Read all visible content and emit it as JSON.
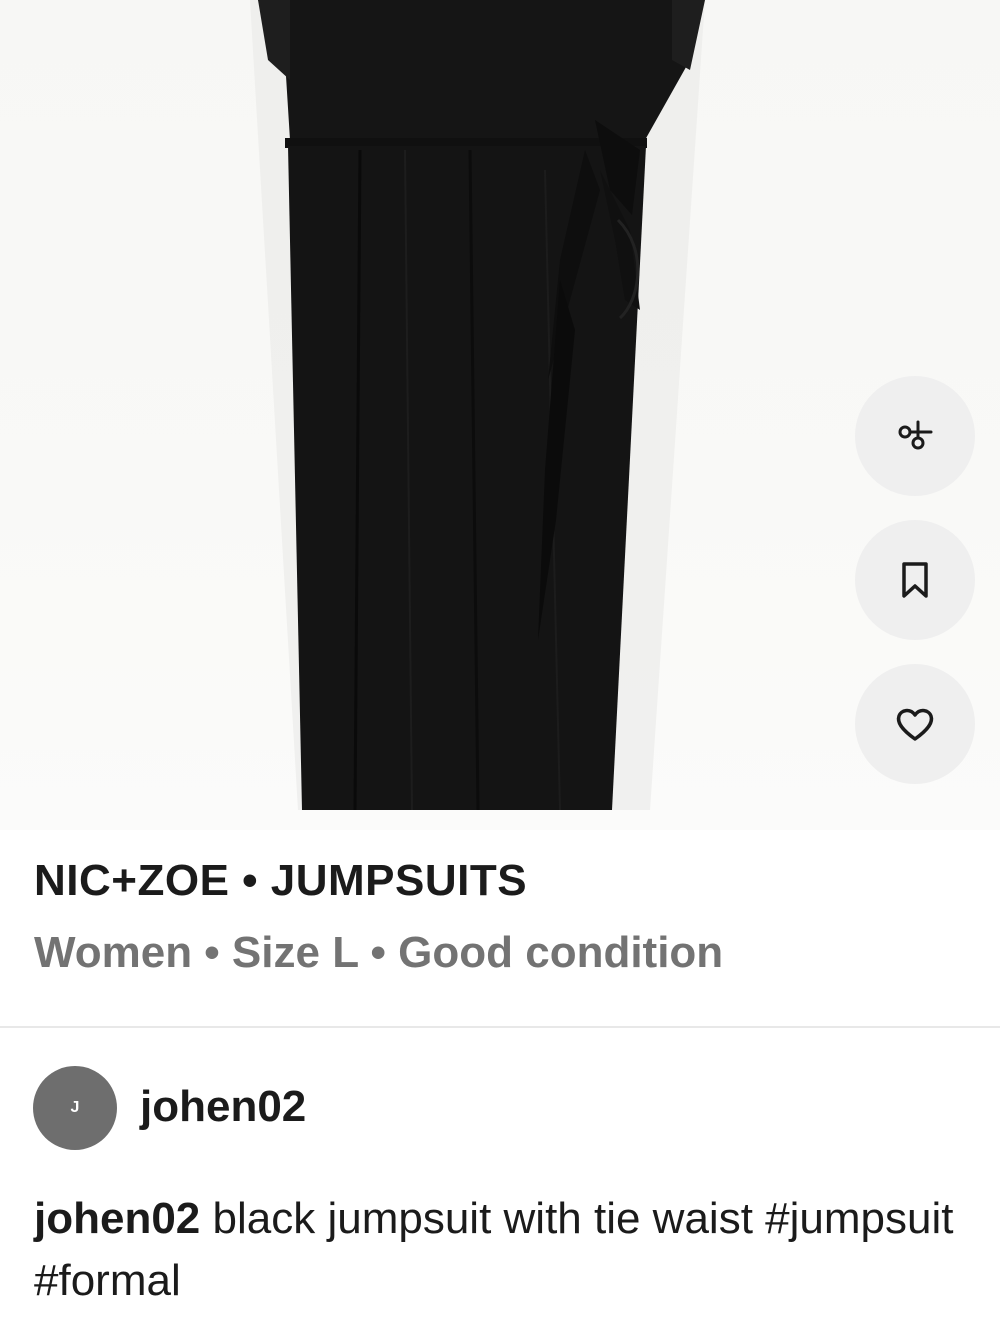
{
  "actions": {
    "share_icon": "share-icon",
    "save_icon": "bookmark-icon",
    "like_icon": "heart-icon"
  },
  "listing": {
    "title": "NIC+ZOE • JUMPSUITS",
    "subtitle": "Women • Size L • Good condition"
  },
  "seller": {
    "avatar_initial": "J",
    "username": "johen02"
  },
  "description": {
    "username": "johen02",
    "text": " black jumpsuit with tie waist #jumpsuit #formal"
  },
  "colors": {
    "garment": "#141414",
    "button_bg": "#efefef",
    "avatar_bg": "#6e6e6e",
    "muted_text": "#737373"
  }
}
